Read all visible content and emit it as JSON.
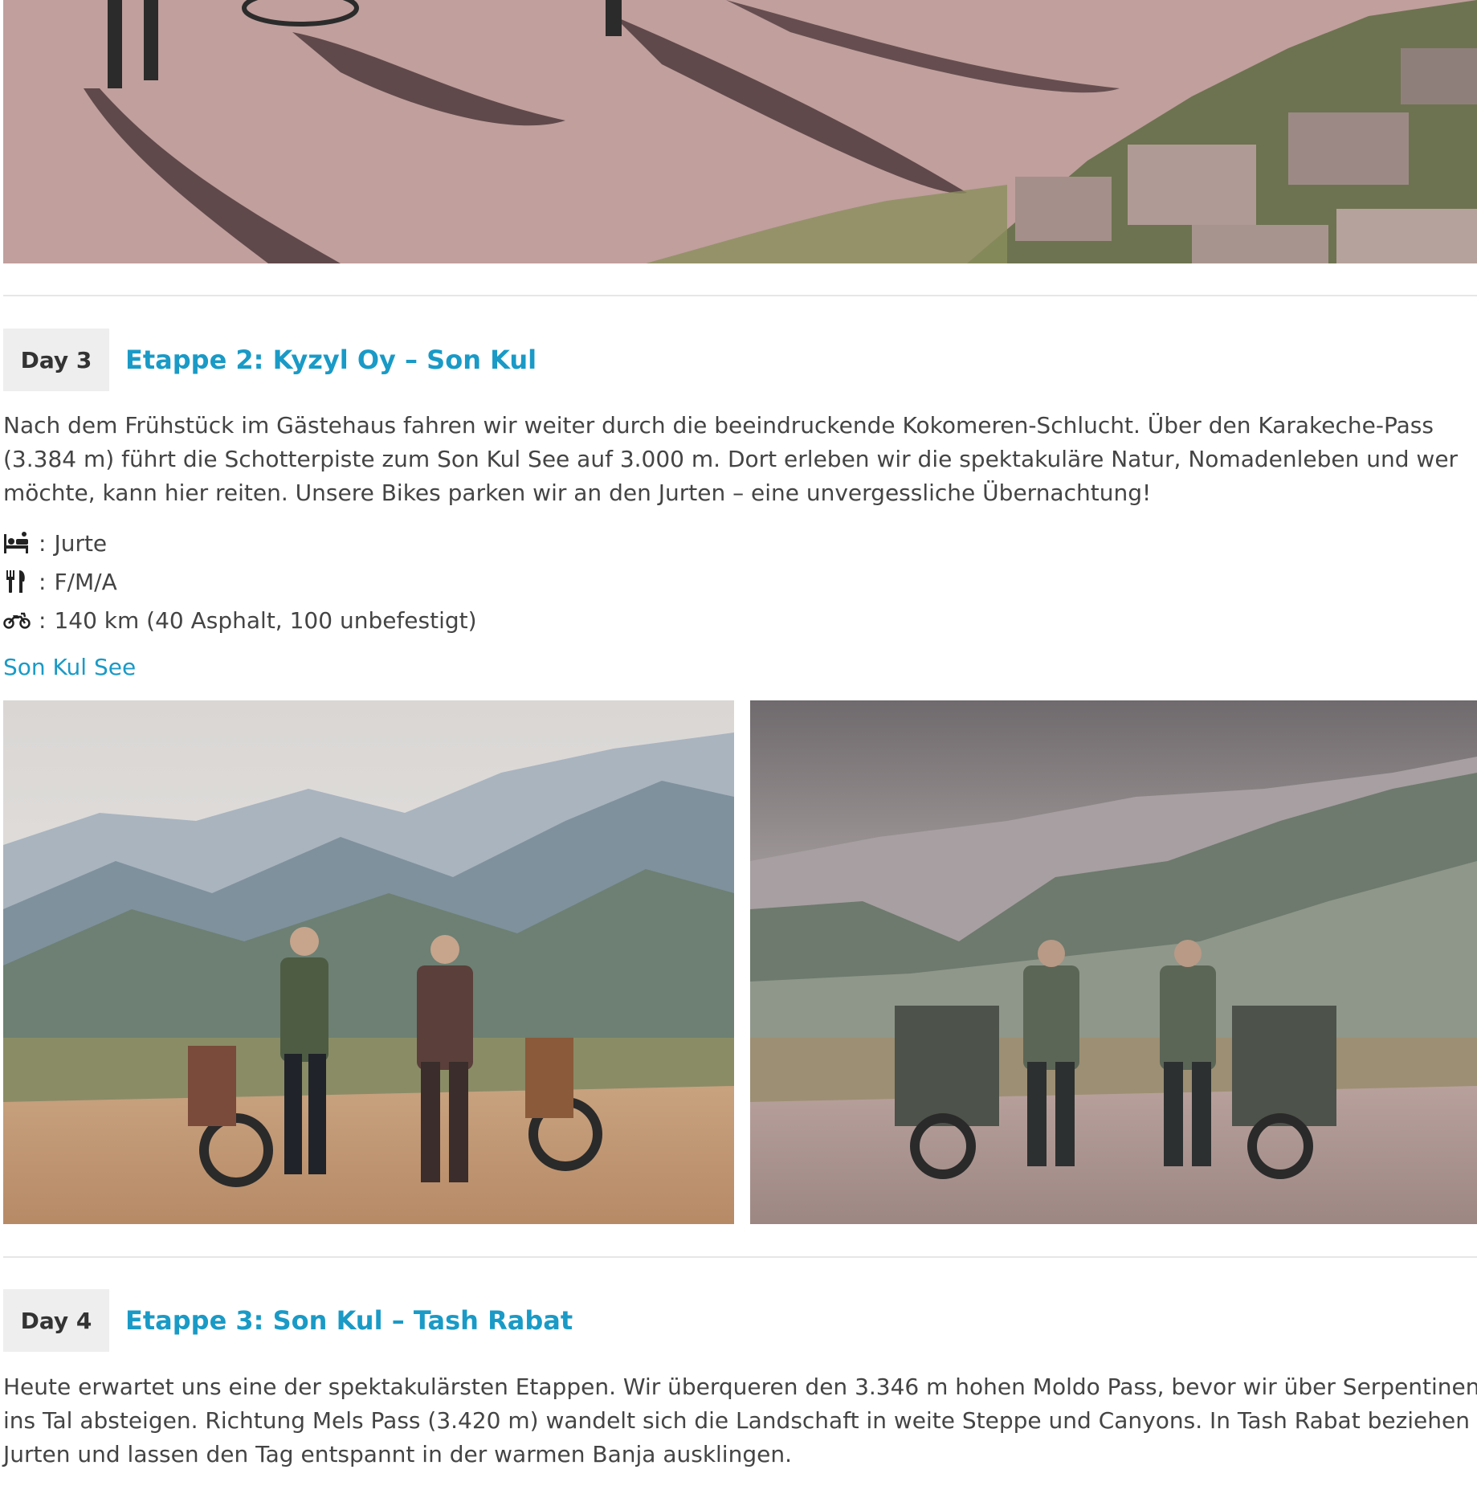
{
  "top_photo": {
    "alt": ""
  },
  "days": [
    {
      "badge": "Day 3",
      "title": "Etappe 2: Kyzyl Oy – Son Kul",
      "description_lines": [
        "Nach dem Frühstück im Gästehaus fahren wir weiter durch die beeindruckende Kokomeren-Schlucht. Über den Karakeche-Pass",
        "(3.384 m) führt die Schotterpiste zum Son Kul See auf 3.000 m. Dort erleben wir die spektakuläre Natur, Nomadenleben und wer",
        "möchte, kann hier reiten. Unsere Bikes parken wir an den Jurten – eine unvergessliche Übernachtung!"
      ],
      "accommodation_icon": "bed-icon",
      "accommodation": "Jurte",
      "meals_icon": "cutlery-icon",
      "meals": "F/M/A",
      "distance_icon": "motorcycle-icon",
      "distance": "140 km (40 Asphalt, 100 unbefestigt)",
      "gallery_link": "Son Kul See"
    },
    {
      "badge": "Day 4",
      "title": "Etappe 3: Son Kul – Tash Rabat",
      "description_lines": [
        "Heute erwartet uns eine der spektakulärsten Etappen. Wir überqueren den 3.346 m hohen Moldo Pass, bevor wir über Serpentinen",
        "ins Tal absteigen. Richtung Mels Pass (3.420 m) wandelt sich die Landschaft in weite Steppe und Canyons. In Tash Rabat beziehen wir",
        "Jurten und lassen den Tag entspannt in der warmen Banja ausklingen."
      ]
    }
  ],
  "separator": ":",
  "colors": {
    "accent": "#1a9ac6",
    "badge_bg": "#eeeeee",
    "text": "#444444",
    "divider": "#e6e6e6"
  }
}
